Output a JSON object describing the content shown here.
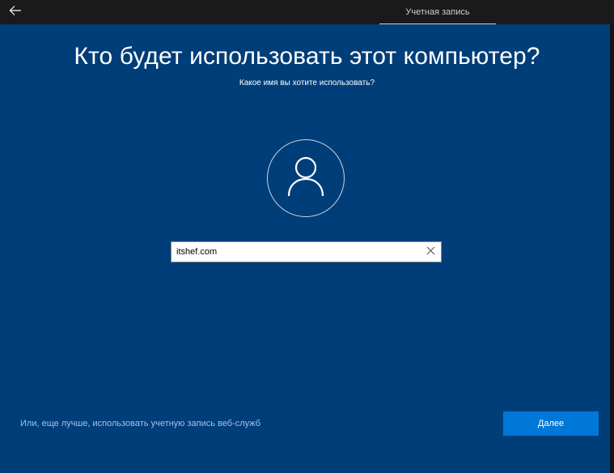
{
  "header": {
    "back_icon": "back-arrow-icon",
    "tab_label": "Учетная запись"
  },
  "main": {
    "title": "Кто будет использовать этот компьютер?",
    "subtitle": "Какое имя вы хотите использовать?",
    "avatar_icon": "user-icon"
  },
  "name_field": {
    "value": "itshef.com",
    "clear_icon": "close-icon"
  },
  "footer": {
    "online_account_link": "Или, еще лучше, использовать учетную запись веб-служб",
    "next_label": "Далее"
  },
  "colors": {
    "background": "#003e79",
    "topbar": "#1a1a1a",
    "accent": "#0078d7",
    "link": "#9cc4ef"
  }
}
